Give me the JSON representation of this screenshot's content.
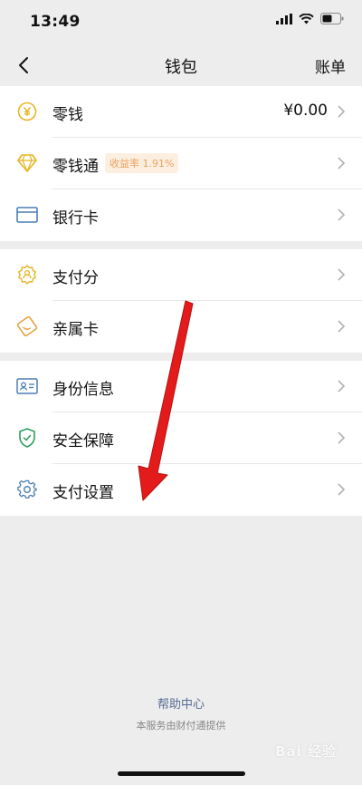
{
  "status_bar": {
    "time": "13:49"
  },
  "nav": {
    "title": "钱包",
    "right_action": "账单"
  },
  "groups": [
    {
      "items": [
        {
          "label": "零钱",
          "value": "¥0.00",
          "icon": "coin-yen-icon"
        },
        {
          "label": "零钱通",
          "badge": "收益率 1.91%",
          "icon": "diamond-icon"
        },
        {
          "label": "银行卡",
          "icon": "bank-card-icon"
        }
      ]
    },
    {
      "items": [
        {
          "label": "支付分",
          "icon": "payment-score-icon"
        },
        {
          "label": "亲属卡",
          "icon": "family-card-icon"
        }
      ]
    },
    {
      "items": [
        {
          "label": "身份信息",
          "icon": "id-card-icon"
        },
        {
          "label": "安全保障",
          "icon": "shield-check-icon"
        },
        {
          "label": "支付设置",
          "icon": "gear-icon"
        }
      ]
    }
  ],
  "footer": {
    "help_link": "帮助中心",
    "note": "本服务由财付通提供"
  },
  "colors": {
    "accent_yellow": "#e6b422",
    "link_blue": "#576b95",
    "arrow_red": "#e31b1b",
    "icon_blue": "#4a7fb5",
    "icon_green": "#2e9e5b"
  },
  "watermark": {
    "text": "Bai 经验"
  }
}
